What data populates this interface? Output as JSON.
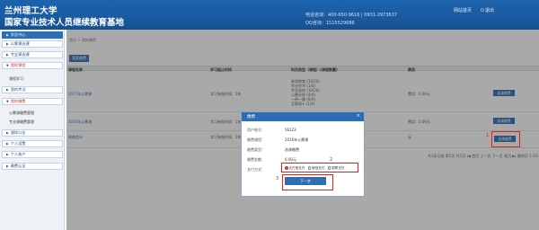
{
  "header": {
    "brand_line1": "兰州理工大学",
    "brand_line2": "国家专业技术人员继续教育基地",
    "phone": "电话咨询：400-650-9616 | 0931-2973637",
    "qq": "QQ咨询：1515529686",
    "link_home": "网站首页",
    "link_logout": "退出"
  },
  "sidebar": {
    "items": [
      {
        "label": "学员中心"
      },
      {
        "label": "公需课选课"
      },
      {
        "label": "专业课选课"
      },
      {
        "label": "我的课程"
      },
      {
        "label": "课程学习"
      },
      {
        "label": "我的考试"
      },
      {
        "label": "我的缴费"
      },
      {
        "label": "公需课缴费管理"
      },
      {
        "label": "专业课缴费管理"
      },
      {
        "label": "通知公告"
      },
      {
        "label": "个人设置"
      },
      {
        "label": "个人账户"
      },
      {
        "label": "缴费认证"
      }
    ]
  },
  "main": {
    "breadcrumb": "首页 > 我的缴费",
    "buy_button": "我要缴费",
    "table_headers": [
      "课程名称",
      "学习起止时间",
      "科目类型（课程）(课程数量)",
      "费用",
      ""
    ],
    "rows": [
      {
        "name": "2017年公需课",
        "term": "学习有效时间：1年",
        "items": [
          "继续教育 (10/20)",
          "专业技术 (1/4)",
          "专业选修 (10/20)",
          "公需必修 (4/4)",
          "一带一路 (0/4)",
          "互联网+ (1/4)"
        ],
        "fee": "费用：0.00元",
        "action": "选课缴费"
      },
      {
        "name": "2016年公需课",
        "term": "学习有效时间：1年",
        "fee": "费用：0.00元",
        "action": "选课缴费"
      },
      {
        "name": "网络会计",
        "term": "学习有效时间：1年",
        "fee": "无",
        "action": "选课缴费"
      }
    ],
    "pager": "共3条记录 第1页 共1页 |◀ 首页 上一页 下一页 尾页 ▶| 跳转页 1 GO"
  },
  "modal": {
    "title": "缴费",
    "fields": [
      {
        "label": "用户账号：",
        "value": "56123"
      },
      {
        "label": "缴费课程：",
        "value": "2016年公需课"
      },
      {
        "label": "缴费类型：",
        "value": "选课缴费"
      },
      {
        "label": "缴费金额：",
        "value": "0.00元"
      },
      {
        "label": "支付方式："
      }
    ],
    "pay_options": [
      "支付宝支付",
      "微信支付",
      "银联支付"
    ],
    "next_button": "下一步"
  },
  "annotations": {
    "n1": "1",
    "n2": "2",
    "n3": "3"
  }
}
